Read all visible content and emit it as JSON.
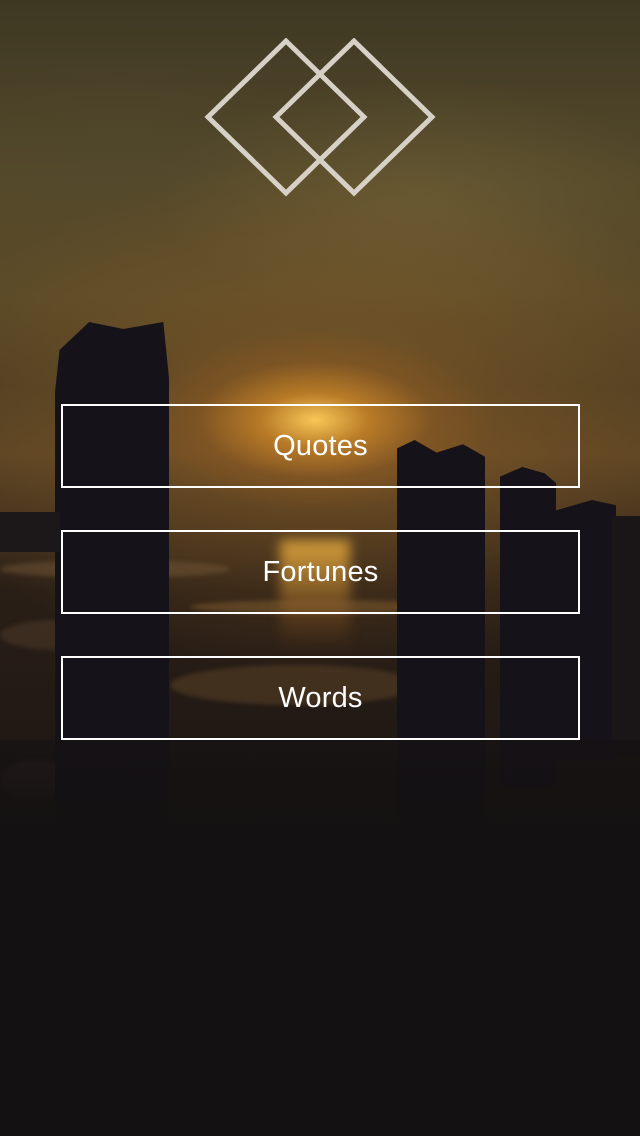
{
  "app": {
    "logo_icon": "overlapping-diamonds-icon",
    "logo_color": "#d6d0c6"
  },
  "menu": {
    "items": [
      {
        "id": "quotes",
        "label": "Quotes"
      },
      {
        "id": "fortunes",
        "label": "Fortunes"
      },
      {
        "id": "words",
        "label": "Words"
      }
    ],
    "border_color": "#ffffff",
    "text_color": "#ffffff"
  },
  "background": {
    "scene": "sunset-over-water-with-wooden-posts"
  }
}
